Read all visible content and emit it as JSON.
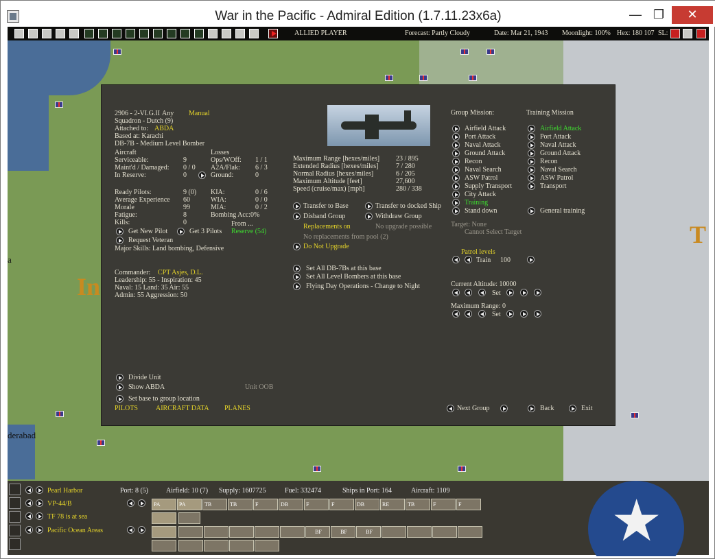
{
  "window": {
    "title": "War in the Pacific - Admiral Edition (1.7.11.23x6a)",
    "min": "—",
    "max": "❐",
    "close": "✕"
  },
  "toolbar": {
    "player": "ALLIED PLAYER",
    "forecast": "Forecast: Partly Cloudy",
    "date": "Date: Mar 21, 1943",
    "moonlight": "Moonlight: 100%",
    "hex": "Hex: 180 107",
    "sl": "SL:"
  },
  "map": {
    "label_in": "In",
    "label_t": "T",
    "label_city": "derabad",
    "label_a": "a"
  },
  "group": {
    "id": "2906 - 2-VI.G.II",
    "any": "Any",
    "manual": "Manual",
    "squadron": "Squadron - Dutch (9)",
    "attached_label": "Attached to:",
    "attached_value": "ABDA",
    "based": "Based at: Karachi",
    "aircraft_type": "DB-7B - Medium Level Bomber",
    "aircraft_label": "Aircraft",
    "losses_label": "Losses",
    "stats": [
      {
        "label": "Serviceable:",
        "value": "9",
        "loss_label": "Ops/WOff:",
        "loss_value": "1 / 1"
      },
      {
        "label": "Maint'd / Damaged:",
        "value": "0 / 0",
        "loss_label": "A2A/Flak:",
        "loss_value": "6 / 3"
      },
      {
        "label": "In Reserve:",
        "value": "0",
        "loss_label": "Ground:",
        "loss_value": "0"
      }
    ],
    "pilots": [
      {
        "label": "Ready Pilots:",
        "value": "9 (0)",
        "side_label": "KIA:",
        "side_value": "0 / 6"
      },
      {
        "label": "Average Experience",
        "value": "60",
        "side_label": "WIA:",
        "side_value": "0 / 0"
      },
      {
        "label": "Morale",
        "value": "99",
        "side_label": "MIA:",
        "side_value": "0 / 2"
      },
      {
        "label": "Fatigue:",
        "value": "8",
        "side_label": "Bombing Acc:",
        "side_value": "0%"
      },
      {
        "label": "Kills:",
        "value": "0",
        "side_label": "From ...",
        "side_value": ""
      }
    ],
    "get_new_pilot": "Get New Pilot",
    "get_3_pilots": "Get 3 Pilots",
    "reserve": "Reserve (54)",
    "request_veteran": "Request Veteran",
    "major_skills": "Major Skills:  Land bombing, Defensive",
    "commander_label": "Commander:",
    "commander_name": "CPT Asjes, D.L.",
    "leadership": "Leadership: 55 - Inspiration: 45",
    "naval": "Naval:  15  Land:  35  Air:  55",
    "admin": "Admin:  55  Aggression:  50"
  },
  "perf": [
    {
      "label": "Maximum Range [hexes/miles]",
      "value": "23 / 895"
    },
    {
      "label": "Extended Radius [hexes/miles]",
      "value": "7 / 280"
    },
    {
      "label": "Normal Radius [hexes/miles]",
      "value": "6 / 205"
    },
    {
      "label": "Maximum Altitude [feet]",
      "value": "27,600"
    },
    {
      "label": "Speed (cruise/max) [mph]",
      "value": "280 / 338"
    }
  ],
  "actions": {
    "transfer_base": "Transfer to Base",
    "transfer_ship": "Transfer to docked Ship",
    "disband": "Disband Group",
    "withdraw": "Withdraw Group",
    "replacements_on": "Replacements on",
    "no_upgrade_possible": "No upgrade possible",
    "no_replacements": "No replacements from pool (2)",
    "do_not_upgrade": "Do Not Upgrade",
    "set_all_db7b": "Set All DB-7Bs at this base",
    "set_all_lvl": "Set All Level Bombers at this base",
    "flying_day": "Flying Day Operations - Change to Night",
    "divide_unit": "Divide Unit",
    "show_abda": "Show ABDA",
    "unit_oob": "Unit OOB",
    "set_base": "Set base to group location",
    "tab_pilots": "PILOTS",
    "tab_aircraft": "AIRCRAFT DATA",
    "tab_planes": "PLANES"
  },
  "missions": {
    "group_header": "Group Mission:",
    "training_header": "Training Mission",
    "group": [
      "Airfield Attack",
      "Port Attack",
      "Naval Attack",
      "Ground Attack",
      "Recon",
      "Naval Search",
      "ASW Patrol",
      "Supply Transport",
      "City Attack",
      "Training",
      "Stand down"
    ],
    "training": [
      "Airfield Attack",
      "Port Attack",
      "Naval Attack",
      "Ground Attack",
      "Recon",
      "Naval Search",
      "ASW Patrol",
      "Transport"
    ],
    "general_training": "General training",
    "target": "Target: None",
    "cannot_select": "Cannot Select Target",
    "patrol_label": "Patrol levels",
    "train_label": "Train",
    "train_value": "100",
    "altitude_label": "Current Altitude: 10000",
    "set": "Set",
    "max_range_label": "Maximum Range: 0"
  },
  "nav": {
    "next_group": "Next Group",
    "back": "Back",
    "exit": "Exit"
  },
  "bottom": {
    "base": "Pearl Harbor",
    "port": "Port: 8 (5)",
    "airfield": "Airfield: 10 (7)",
    "supply": "Supply: 1607725",
    "fuel": "Fuel: 332474",
    "ships": "Ships in Port: 164",
    "aircraft": "Aircraft: 1109",
    "air_unit": "VP-44/B",
    "task_force": "TF 78 is at sea",
    "hq": "Pacific Ocean Areas",
    "air_buttons": [
      "PA",
      "PA",
      "TB",
      "TB",
      "F",
      "DB",
      "F",
      "F",
      "DB",
      "RE",
      "TB",
      "F",
      "F"
    ],
    "unit_buttons": [
      "BF",
      "BF",
      "BF"
    ]
  },
  "colors": {
    "panel": "#3b3a35",
    "yellow": "#e6d52a",
    "green": "#3ee030",
    "close": "#c73b32",
    "roundel": "#244a8e"
  }
}
